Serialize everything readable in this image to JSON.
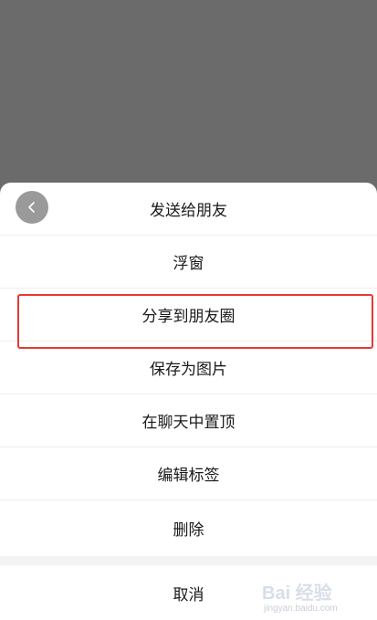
{
  "menu": {
    "items": [
      {
        "label": "发送给朋友"
      },
      {
        "label": "浮窗"
      },
      {
        "label": "分享到朋友圈"
      },
      {
        "label": "保存为图片"
      },
      {
        "label": "在聊天中置顶"
      },
      {
        "label": "编辑标签"
      },
      {
        "label": "删除"
      }
    ],
    "cancel_label": "取消"
  },
  "icons": {
    "back": "chevron-left-icon"
  },
  "colors": {
    "backdrop": "#6b6b6b",
    "sheet": "#ffffff",
    "highlight": "#e53935",
    "back_button": "#9a9a9a"
  },
  "watermark": {
    "brand": "Bai 经验",
    "url": "jingyan.baidu.com"
  }
}
